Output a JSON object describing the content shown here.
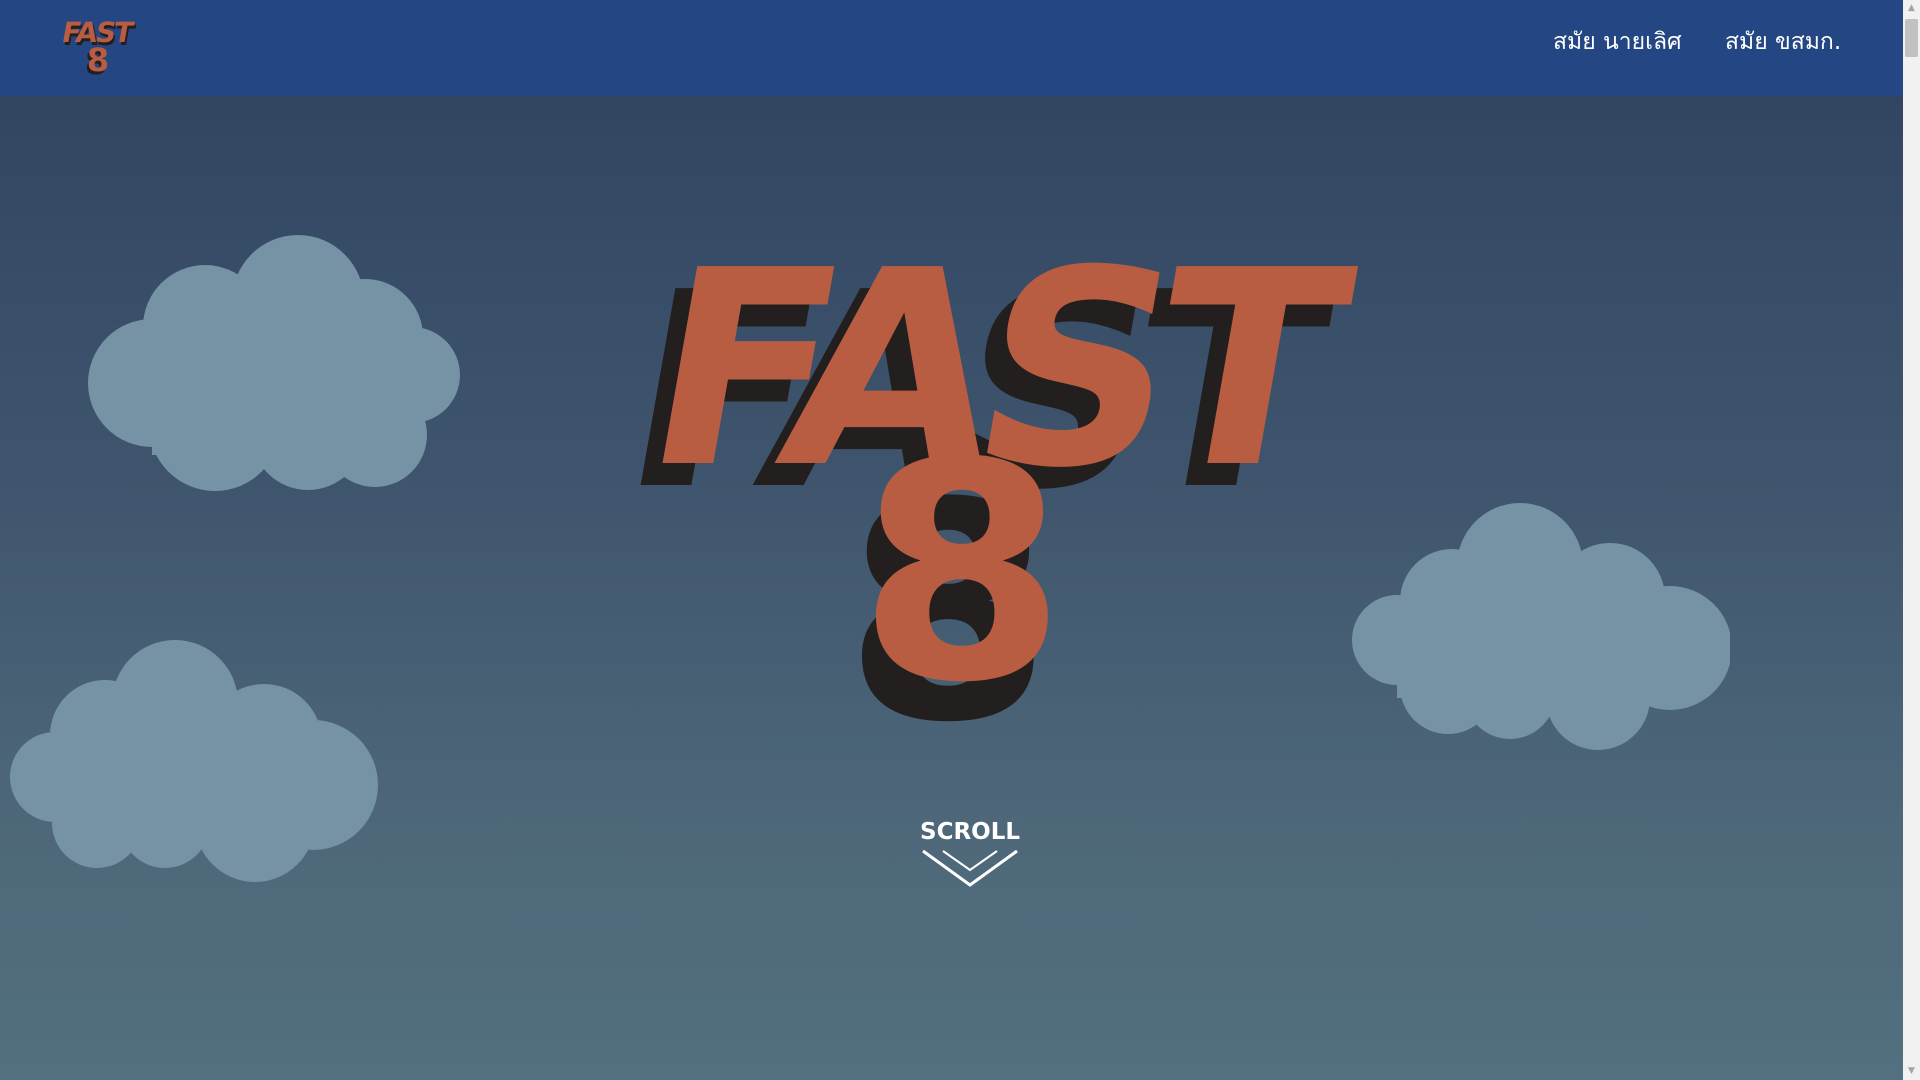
{
  "nav": {
    "logo_line1": "FAST",
    "logo_line2": "8",
    "links": [
      {
        "label": "สมัย นายเลิศ"
      },
      {
        "label": "สมัย ขสมก."
      }
    ]
  },
  "hero": {
    "title_line1": "FAST",
    "title_line2": "8",
    "scroll_label": "SCROLL"
  },
  "colors": {
    "nav_background": "#244683",
    "logo_orange": "#b85d41",
    "logo_shadow": "#231f1e",
    "cloud": "#7593a5",
    "sky_top": "#2f4059",
    "sky_bottom": "#52707f",
    "nav_text": "#ffffff"
  },
  "icons": {
    "scroll_arrow": "chevron-down-icon",
    "scrollbar_up": "triangle-up-icon",
    "scrollbar_down": "triangle-down-icon"
  }
}
